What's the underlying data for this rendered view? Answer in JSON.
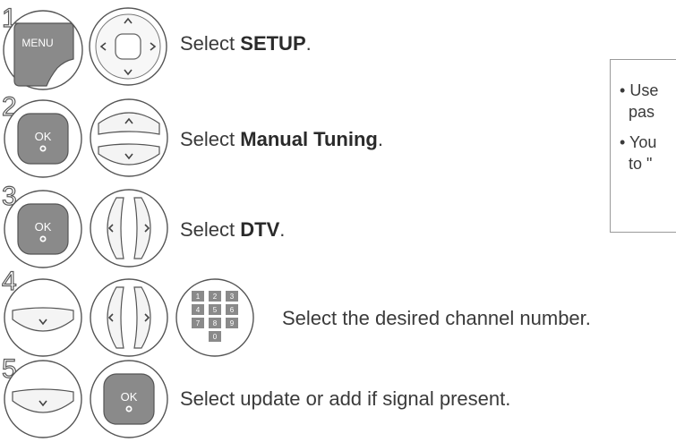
{
  "steps": [
    {
      "number": "1",
      "prefix": "Select ",
      "bold": "SETUP",
      "suffix": "."
    },
    {
      "number": "2",
      "prefix": "Select ",
      "bold": "Manual Tuning",
      "suffix": "."
    },
    {
      "number": "3",
      "prefix": "Select ",
      "bold": "DTV",
      "suffix": "."
    },
    {
      "number": "4",
      "prefix": "Select the desired channel number.",
      "bold": "",
      "suffix": ""
    },
    {
      "number": "5",
      "prefix": "Select update or add if signal present.",
      "bold": "",
      "suffix": ""
    }
  ],
  "buttons": {
    "menu_label": "MENU",
    "ok_label": "OK",
    "numpad_keys": [
      "1",
      "2",
      "3",
      "4",
      "5",
      "6",
      "7",
      "8",
      "9",
      "0"
    ]
  },
  "notes": [
    {
      "bullet": "•",
      "line1": "Use",
      "line2": "pas"
    },
    {
      "bullet": "•",
      "line1": "You",
      "line2": "to \""
    }
  ],
  "colors": {
    "button_dark": "#8a8a8a",
    "button_light": "#f4f4f4",
    "outline": "#555555",
    "text": "#3a3a3a"
  }
}
